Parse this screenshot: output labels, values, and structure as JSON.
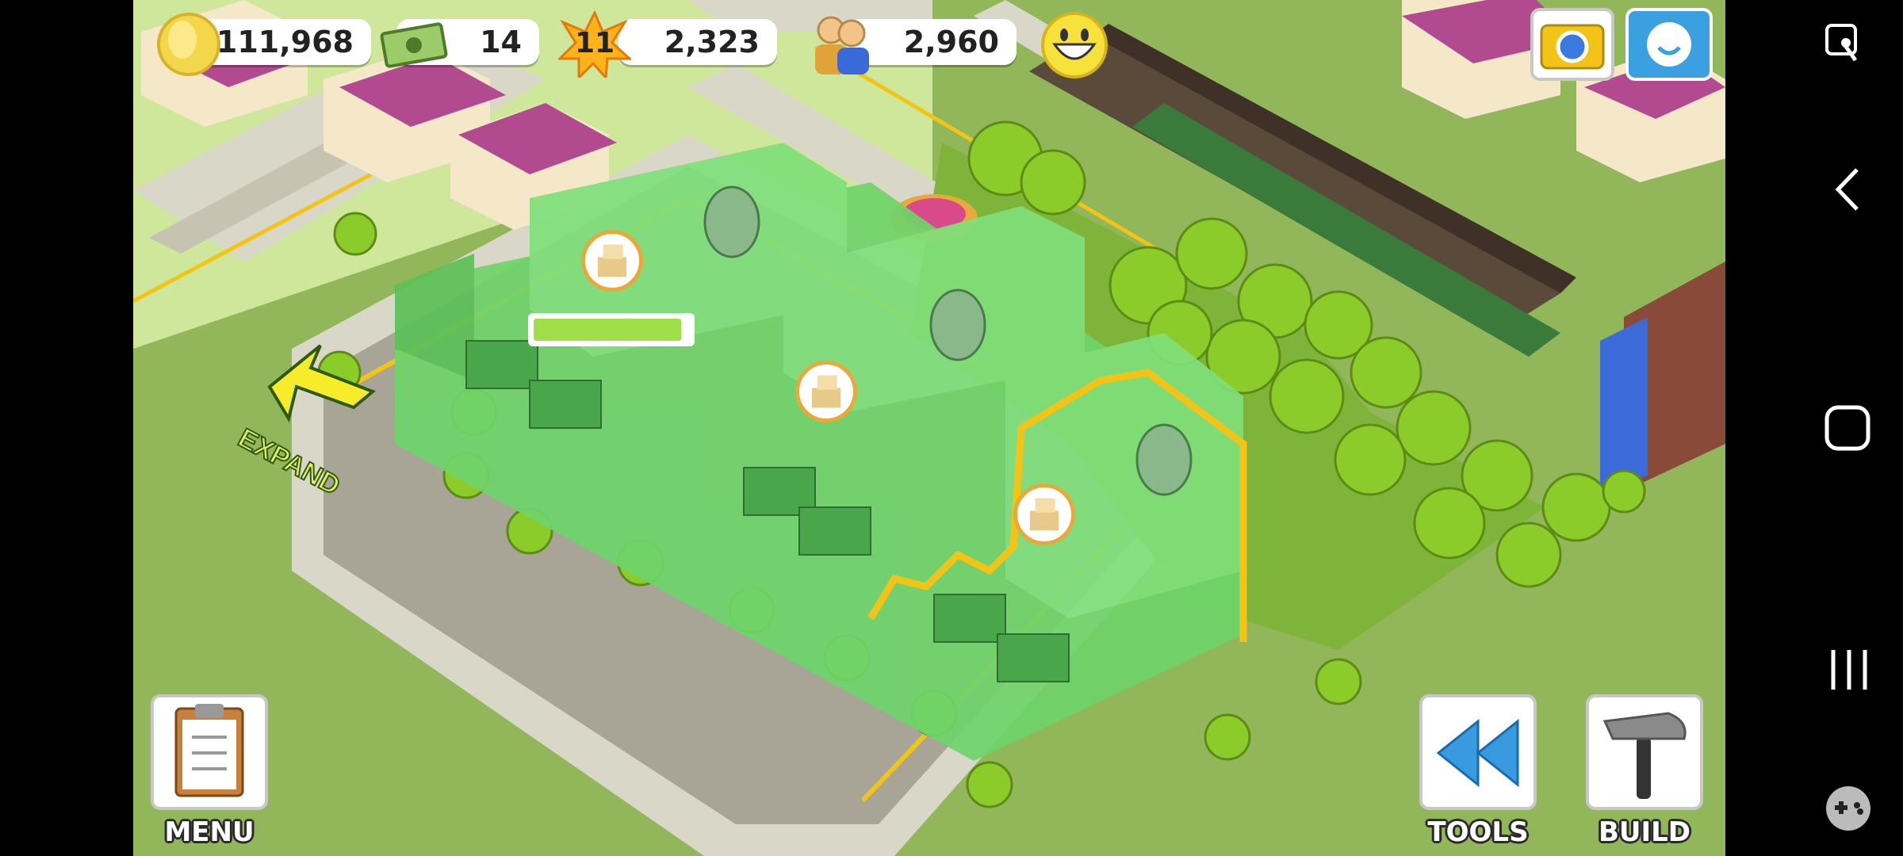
{
  "hud": {
    "coins": "111,968",
    "cash": "14",
    "level": "11",
    "xp": "2,323",
    "population": "2,960"
  },
  "buttons": {
    "expand": "EXPAND",
    "menu": "MENU",
    "tools": "TOOLS",
    "build": "BUILD"
  },
  "progress": {
    "fraction": 0.95
  },
  "colors": {
    "grass": "#92b65a",
    "road": "#d9d7c8",
    "building": "#6fd46a",
    "highlight": "#f2c417",
    "accent_blue": "#3aa0e0"
  },
  "icons": {
    "coin": "coin-icon",
    "cash": "cash-icon",
    "level": "level-star-icon",
    "population": "population-icon",
    "happiness": "happy-face-icon",
    "camera": "camera-icon",
    "share": "share-icon",
    "menu": "clipboard-icon",
    "tools": "rewind-icon",
    "build": "hammer-icon",
    "nav_accessibility": "accessibility-icon",
    "nav_back": "back-icon",
    "nav_home": "home-icon",
    "nav_recent": "recent-apps-icon",
    "nav_game": "gamepad-icon"
  }
}
